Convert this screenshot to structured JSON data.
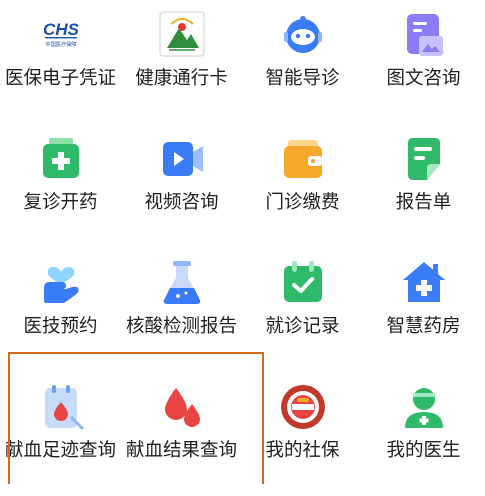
{
  "colors": {
    "accent_blue": "#3a7bf6",
    "accent_green": "#2fba69",
    "accent_red": "#e84545",
    "accent_orange": "#f4a82c",
    "highlight_border": "#d2691e"
  },
  "grid": {
    "items": [
      {
        "label": "医保电子凭证",
        "icon": "chs-logo-icon"
      },
      {
        "label": "健康通行卡",
        "icon": "health-pass-icon"
      },
      {
        "label": "智能导诊",
        "icon": "smart-guide-icon"
      },
      {
        "label": "图文咨询",
        "icon": "image-text-consult-icon"
      },
      {
        "label": "复诊开药",
        "icon": "medicine-box-icon"
      },
      {
        "label": "视频咨询",
        "icon": "video-camera-icon"
      },
      {
        "label": "门诊缴费",
        "icon": "wallet-icon"
      },
      {
        "label": "报告单",
        "icon": "report-doc-icon"
      },
      {
        "label": "医技预约",
        "icon": "hand-heart-icon"
      },
      {
        "label": "核酸检测报告",
        "icon": "flask-icon"
      },
      {
        "label": "就诊记录",
        "icon": "calendar-check-icon"
      },
      {
        "label": "智慧药房",
        "icon": "pharmacy-house-icon"
      },
      {
        "label": "献血足迹查询",
        "icon": "blood-record-icon"
      },
      {
        "label": "献血结果查询",
        "icon": "blood-drops-icon"
      },
      {
        "label": "我的社保",
        "icon": "social-security-seal-icon"
      },
      {
        "label": "我的医生",
        "icon": "doctor-avatar-icon"
      }
    ],
    "chs_text": "CHS",
    "chs_subtext": "中国医疗保障"
  }
}
